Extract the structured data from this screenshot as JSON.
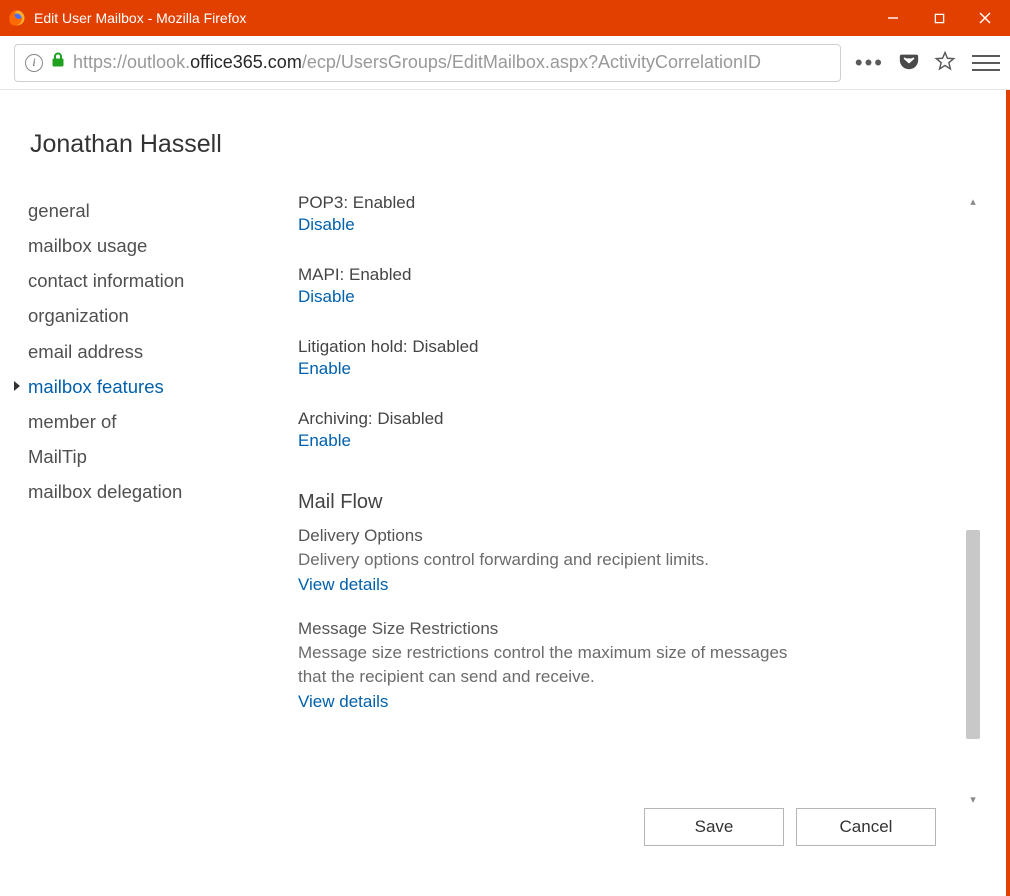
{
  "window": {
    "title": "Edit User Mailbox - Mozilla Firefox"
  },
  "url": {
    "host_dim": "https://outlook.",
    "host_strong": "office365.com",
    "path": "/ecp/UsersGroups/EditMailbox.aspx?ActivityCorrelationID"
  },
  "page": {
    "title": "Jonathan Hassell"
  },
  "sidenav": [
    {
      "label": "general",
      "active": false
    },
    {
      "label": "mailbox usage",
      "active": false
    },
    {
      "label": "contact information",
      "active": false
    },
    {
      "label": "organization",
      "active": false
    },
    {
      "label": "email address",
      "active": false
    },
    {
      "label": "mailbox features",
      "active": true
    },
    {
      "label": "member of",
      "active": false
    },
    {
      "label": "MailTip",
      "active": false
    },
    {
      "label": "mailbox delegation",
      "active": false
    }
  ],
  "settings": [
    {
      "label": "POP3: Enabled",
      "action": "Disable"
    },
    {
      "label": "MAPI: Enabled",
      "action": "Disable"
    },
    {
      "label": "Litigation hold: Disabled",
      "action": "Enable"
    },
    {
      "label": "Archiving: Disabled",
      "action": "Enable"
    }
  ],
  "mailflow": {
    "heading": "Mail Flow",
    "groups": [
      {
        "title": "Delivery Options",
        "desc": "Delivery options control forwarding and recipient limits.",
        "link": "View details"
      },
      {
        "title": "Message Size Restrictions",
        "desc": "Message size restrictions control the maximum size of messages that the recipient can send and receive.",
        "link": "View details"
      }
    ]
  },
  "footer": {
    "save": "Save",
    "cancel": "Cancel"
  }
}
